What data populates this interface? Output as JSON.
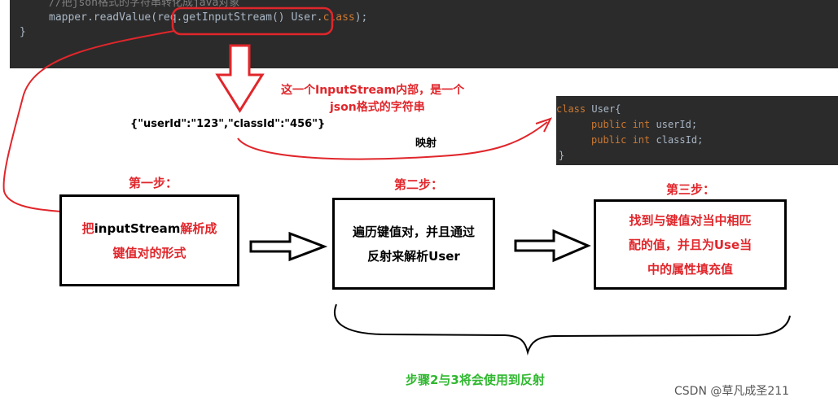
{
  "code_top": {
    "comment": "//把json格式的字符串转化成java对象",
    "line_obj": "mapper.",
    "line_method": "readValue(",
    "line_arg": "req.getInputStream()",
    "line_rest": " User.",
    "line_class": "class",
    "line_end": ");",
    "brace": "}"
  },
  "code_right": {
    "line1_kw": "class",
    "line1_name": " User{",
    "line2_kw": "public",
    "line2_type": " int",
    "line2_field": " userId;",
    "line3_kw": "public",
    "line3_type": " int",
    "line3_field": " classId;",
    "brace": "}"
  },
  "annotations": {
    "inputstream_note_1": "这一个InputStream内部，是一个",
    "inputstream_note_2": "json格式的字符串",
    "json_sample": "{\"userId\":\"123\",\"classId\":\"456\"}",
    "mapping": "映射"
  },
  "steps": [
    {
      "title": "第一步：",
      "text_red_1": "把",
      "text_black": "inputStream",
      "text_red_2": "解析成",
      "line2": "键值对的形式"
    },
    {
      "title": "第二步：",
      "line1": "遍历键值对，并且通过",
      "line2": "反射来解析User"
    },
    {
      "title": "第三步：",
      "line1": "找到与键值对当中相匹",
      "line2": "配的值，并且为Use当",
      "line3": "中的属性填充值"
    }
  ],
  "bottom_note": "步骤2与3将会使用到反射",
  "watermark": "CSDN @草凡成圣211",
  "colors": {
    "red": "#e0262b",
    "green": "#2fb82f",
    "code_bg": "#2b2b2b",
    "keyword": "#cc7832"
  }
}
